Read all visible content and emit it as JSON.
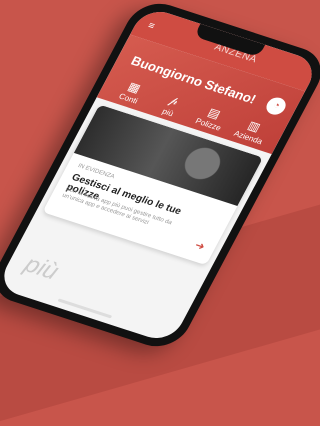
{
  "app": {
    "title": "Buongiorno Stefano!",
    "logo_text": "più"
  },
  "header": {
    "center_text": "ANZENA",
    "left_icon": "menu-icon",
    "profile_icon": "profile-icon"
  },
  "features": [
    {
      "label": "Conti",
      "icon": "grid-icon"
    },
    {
      "label": "più",
      "icon": "brand-icon"
    },
    {
      "label": "Polizze",
      "icon": "document-icon"
    },
    {
      "label": "Azienda",
      "icon": "building-icon"
    }
  ],
  "card": {
    "tag": "IN EVIDENZA",
    "title": "Gestisci al meglio le tue polizze",
    "body": "Con la nuova app più puoi gestire tutto da un'unica app e accedere ai servizi",
    "action_icon": "arrow-right-icon"
  },
  "colors": {
    "brand": "#cf4c42",
    "background": "#c8554b"
  }
}
